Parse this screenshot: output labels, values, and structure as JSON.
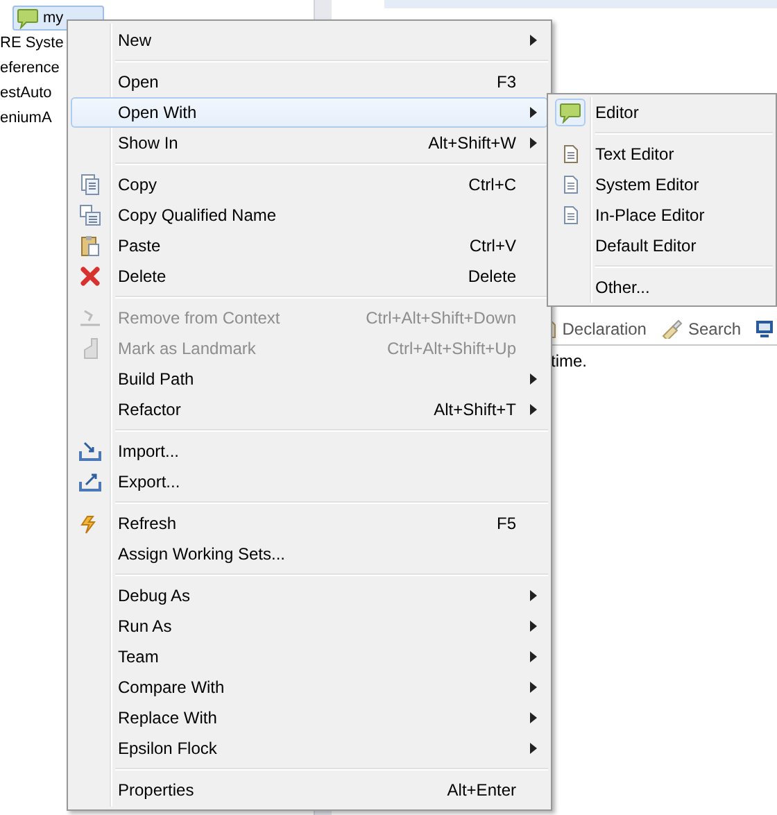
{
  "tree": {
    "items": [
      {
        "label": "my",
        "kind": "feature",
        "selected": true
      },
      {
        "label": "RE Syste",
        "kind": "none",
        "selected": false
      },
      {
        "label": "eference",
        "kind": "none",
        "selected": false
      },
      {
        "label": "estAuto",
        "kind": "none",
        "selected": false
      },
      {
        "label": "eniumA",
        "kind": "none",
        "selected": false
      }
    ]
  },
  "views": {
    "tabs": [
      {
        "label": "Declaration",
        "kind": "declaration"
      },
      {
        "label": "Search",
        "kind": "search"
      },
      {
        "kind": "console"
      }
    ],
    "console_text": "time."
  },
  "context_menu": {
    "groups": [
      [
        {
          "label": "New",
          "submenu": true,
          "disabled": false,
          "selected": false,
          "kind": "none"
        }
      ],
      [
        {
          "label": "Open",
          "shortcut": "F3",
          "submenu": false,
          "disabled": false,
          "selected": false,
          "kind": "none"
        },
        {
          "label": "Open With",
          "submenu": true,
          "disabled": false,
          "selected": true,
          "kind": "none"
        },
        {
          "label": "Show In",
          "shortcut": "Alt+Shift+W",
          "submenu": true,
          "disabled": false,
          "selected": false,
          "kind": "none"
        }
      ],
      [
        {
          "label": "Copy",
          "shortcut": "Ctrl+C",
          "submenu": false,
          "disabled": false,
          "selected": false,
          "kind": "copy"
        },
        {
          "label": "Copy Qualified Name",
          "submenu": false,
          "disabled": false,
          "selected": false,
          "kind": "copy-name"
        },
        {
          "label": "Paste",
          "shortcut": "Ctrl+V",
          "submenu": false,
          "disabled": false,
          "selected": false,
          "kind": "paste"
        },
        {
          "label": "Delete",
          "shortcut": "Delete",
          "submenu": false,
          "disabled": false,
          "selected": false,
          "kind": "delete"
        }
      ],
      [
        {
          "label": "Remove from Context",
          "shortcut": "Ctrl+Alt+Shift+Down",
          "submenu": false,
          "disabled": true,
          "selected": false,
          "kind": "remove"
        },
        {
          "label": "Mark as Landmark",
          "shortcut": "Ctrl+Alt+Shift+Up",
          "submenu": false,
          "disabled": true,
          "selected": false,
          "kind": "landmark"
        },
        {
          "label": "Build Path",
          "submenu": true,
          "disabled": false,
          "selected": false,
          "kind": "none"
        },
        {
          "label": "Refactor",
          "shortcut": "Alt+Shift+T",
          "submenu": true,
          "disabled": false,
          "selected": false,
          "kind": "none"
        }
      ],
      [
        {
          "label": "Import...",
          "submenu": false,
          "disabled": false,
          "selected": false,
          "kind": "import"
        },
        {
          "label": "Export...",
          "submenu": false,
          "disabled": false,
          "selected": false,
          "kind": "export"
        }
      ],
      [
        {
          "label": "Refresh",
          "shortcut": "F5",
          "submenu": false,
          "disabled": false,
          "selected": false,
          "kind": "refresh"
        },
        {
          "label": "Assign Working Sets...",
          "submenu": false,
          "disabled": false,
          "selected": false,
          "kind": "none"
        }
      ],
      [
        {
          "label": "Debug As",
          "submenu": true,
          "disabled": false,
          "selected": false,
          "kind": "none"
        },
        {
          "label": "Run As",
          "submenu": true,
          "disabled": false,
          "selected": false,
          "kind": "none"
        },
        {
          "label": "Team",
          "submenu": true,
          "disabled": false,
          "selected": false,
          "kind": "none"
        },
        {
          "label": "Compare With",
          "submenu": true,
          "disabled": false,
          "selected": false,
          "kind": "none"
        },
        {
          "label": "Replace With",
          "submenu": true,
          "disabled": false,
          "selected": false,
          "kind": "none"
        },
        {
          "label": "Epsilon Flock",
          "submenu": true,
          "disabled": false,
          "selected": false,
          "kind": "none"
        }
      ],
      [
        {
          "label": "Properties",
          "shortcut": "Alt+Enter",
          "submenu": false,
          "disabled": false,
          "selected": false,
          "kind": "none"
        }
      ]
    ]
  },
  "submenu": {
    "groups": [
      [
        {
          "label": "Editor",
          "checked": true,
          "kind": "feature"
        }
      ],
      [
        {
          "label": "Text Editor",
          "checked": false,
          "kind": "text"
        },
        {
          "label": "System Editor",
          "checked": false,
          "kind": "doc"
        },
        {
          "label": "In-Place Editor",
          "checked": false,
          "kind": "doc"
        },
        {
          "label": "Default Editor",
          "checked": false,
          "kind": "none"
        }
      ],
      [
        {
          "label": "Other...",
          "checked": false,
          "kind": "none"
        }
      ]
    ]
  }
}
